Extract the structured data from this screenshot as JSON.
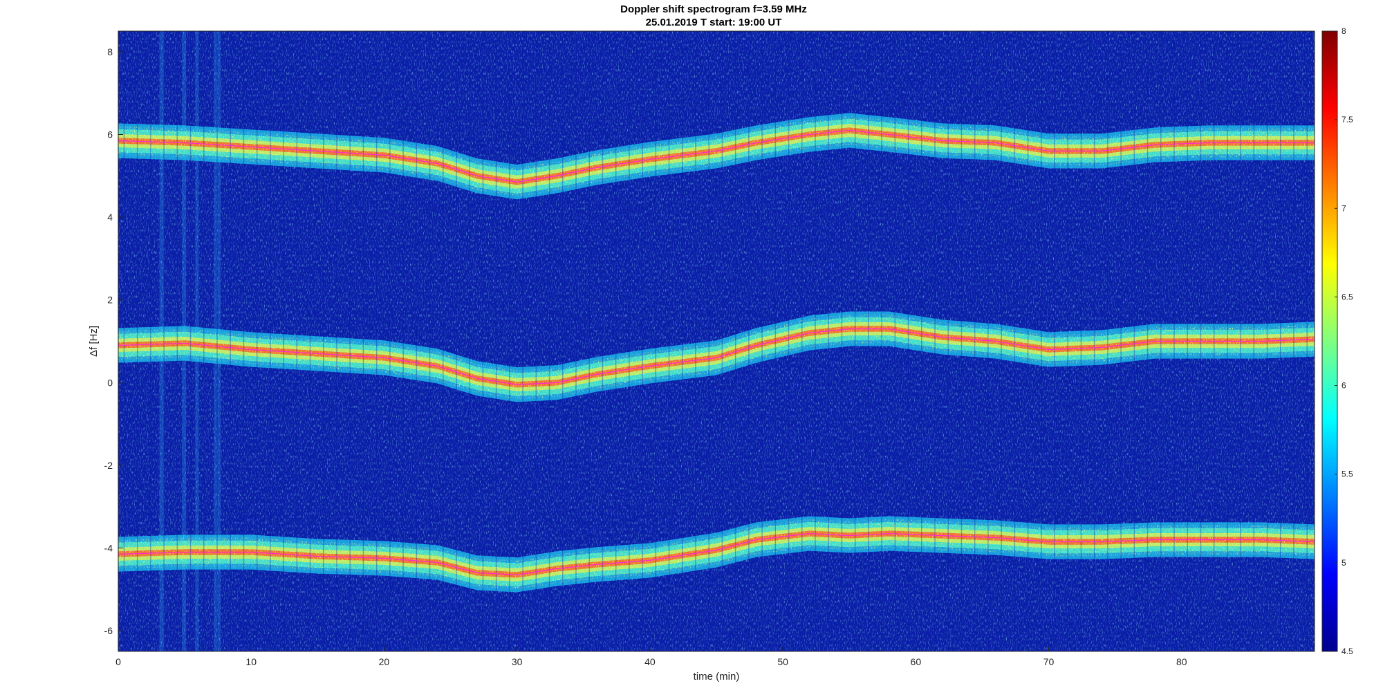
{
  "chart_data": {
    "type": "heatmap",
    "title": "Doppler shift spectrogram f=3.59 MHz",
    "subtitle": "25.01.2019   T start: 19:00 UT",
    "xlabel": "time (min)",
    "ylabel": "Δf [Hz]",
    "xlim": [
      0,
      90
    ],
    "ylim": [
      -6.5,
      8.5
    ],
    "xticks": [
      0,
      10,
      20,
      30,
      40,
      50,
      60,
      70,
      80
    ],
    "yticks": [
      8,
      6,
      4,
      2,
      0,
      -2,
      -4,
      -6
    ],
    "colormap": "jet",
    "clim": [
      4.5,
      8
    ],
    "colorbar_ticks": [
      8,
      7.5,
      7,
      6.5,
      6,
      5.5,
      5,
      4.5
    ],
    "background_color": "#0a1ea8",
    "traces": [
      {
        "x": [
          0,
          5,
          10,
          15,
          20,
          24,
          27,
          30,
          33,
          36,
          40,
          45,
          48,
          52,
          55,
          58,
          62,
          66,
          70,
          74,
          78,
          82,
          86,
          90
        ],
        "y": [
          5.85,
          5.8,
          5.7,
          5.6,
          5.5,
          5.3,
          5.0,
          4.85,
          5.0,
          5.2,
          5.4,
          5.6,
          5.8,
          6.0,
          6.1,
          6.0,
          5.85,
          5.8,
          5.6,
          5.6,
          5.75,
          5.8,
          5.8,
          5.8
        ]
      },
      {
        "x": [
          0,
          5,
          10,
          15,
          20,
          24,
          27,
          30,
          33,
          36,
          40,
          45,
          48,
          52,
          55,
          58,
          62,
          66,
          70,
          74,
          78,
          82,
          86,
          90
        ],
        "y": [
          0.9,
          0.95,
          0.8,
          0.7,
          0.6,
          0.4,
          0.1,
          -0.05,
          0.0,
          0.2,
          0.4,
          0.6,
          0.9,
          1.2,
          1.3,
          1.3,
          1.1,
          1.0,
          0.8,
          0.85,
          1.0,
          1.0,
          1.0,
          1.05
        ]
      },
      {
        "x": [
          0,
          5,
          10,
          15,
          20,
          24,
          27,
          30,
          33,
          36,
          40,
          45,
          48,
          52,
          55,
          58,
          62,
          66,
          70,
          74,
          78,
          82,
          86,
          90
        ],
        "y": [
          -4.15,
          -4.1,
          -4.1,
          -4.2,
          -4.25,
          -4.35,
          -4.6,
          -4.65,
          -4.5,
          -4.4,
          -4.3,
          -4.05,
          -3.8,
          -3.65,
          -3.7,
          -3.65,
          -3.7,
          -3.75,
          -3.85,
          -3.85,
          -3.8,
          -3.8,
          -3.8,
          -3.85
        ]
      }
    ],
    "trace_color": "#ff2ad4"
  }
}
